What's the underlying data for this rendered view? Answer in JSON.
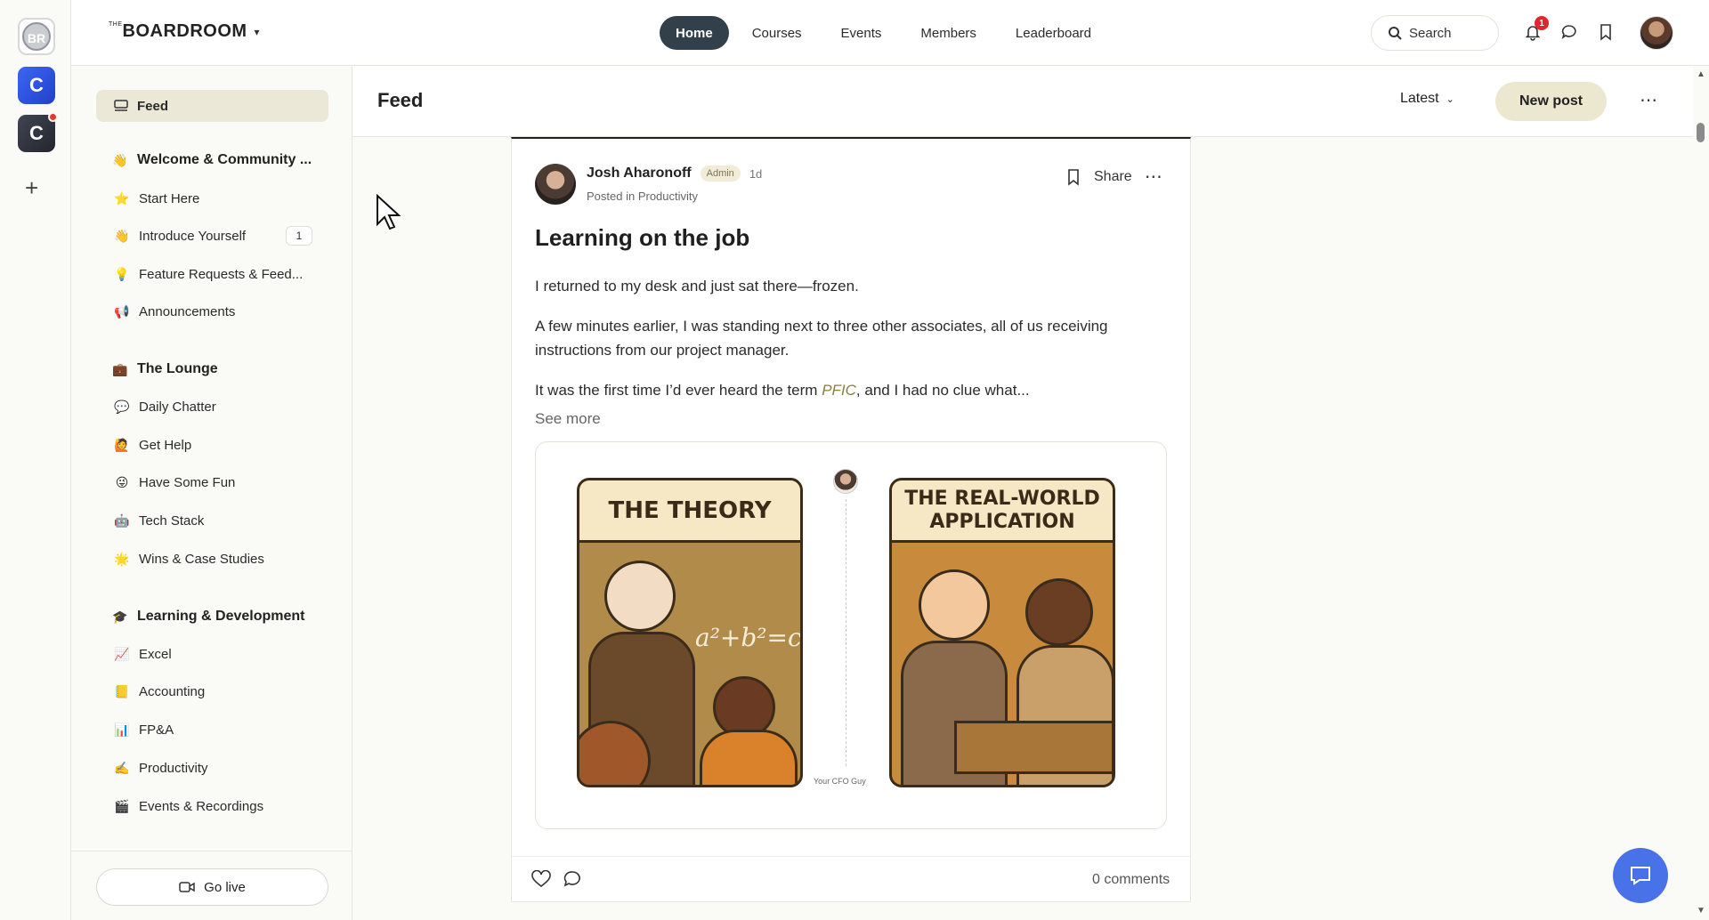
{
  "rail": {
    "apps": [
      {
        "label": "BR"
      },
      {
        "label": "C"
      },
      {
        "label": "C"
      }
    ],
    "add": "+"
  },
  "header": {
    "logo_small": "THE",
    "logo_main": "BOARDROOM",
    "nav": [
      "Home",
      "Courses",
      "Events",
      "Members",
      "Leaderboard"
    ],
    "search_label": "Search",
    "notification_count": "1"
  },
  "sidebar": {
    "feed": "Feed",
    "sections": [
      {
        "title": "Welcome & Community ...",
        "emoji": "👋",
        "items": [
          {
            "label": "Start Here",
            "emoji": "⭐"
          },
          {
            "label": "Introduce Yourself",
            "emoji": "👋",
            "count": "1"
          },
          {
            "label": "Feature Requests & Feed...",
            "emoji": "💡"
          },
          {
            "label": "Announcements",
            "emoji": "📢"
          }
        ]
      },
      {
        "title": "The Lounge",
        "emoji": "💼",
        "items": [
          {
            "label": "Daily Chatter",
            "emoji": "💬"
          },
          {
            "label": "Get Help",
            "emoji": "🙋"
          },
          {
            "label": "Have Some Fun",
            "emoji": "😜"
          },
          {
            "label": "Tech Stack",
            "emoji": "🤖"
          },
          {
            "label": "Wins & Case Studies",
            "emoji": "🌟"
          }
        ]
      },
      {
        "title": "Learning & Development",
        "emoji": "🎓",
        "items": [
          {
            "label": "Excel",
            "emoji": "📈"
          },
          {
            "label": "Accounting",
            "emoji": "📒"
          },
          {
            "label": "FP&A",
            "emoji": "📊"
          },
          {
            "label": "Productivity",
            "emoji": "✍️"
          },
          {
            "label": "Events & Recordings",
            "emoji": "🎬"
          }
        ]
      }
    ],
    "go_live": "Go live"
  },
  "feed": {
    "title": "Feed",
    "sort": "Latest",
    "new_post": "New post",
    "post": {
      "author": "Josh Aharonoff",
      "role": "Admin",
      "time": "1d",
      "posted_in_prefix": "Posted in",
      "posted_in": "Productivity",
      "share": "Share",
      "title": "Learning on the job",
      "p1": "I returned to my desk and just sat there—frozen.",
      "p2": "A few minutes earlier, I was standing next to three other associates, all of us receiving instructions from our project manager.",
      "p3_before": "It was the first time I’d ever heard the term ",
      "p3_term": "PFIC",
      "p3_after": ", and I had no clue what...",
      "see_more": "See more",
      "image": {
        "left_caption": "THE THEORY",
        "left_equation": "a²+b²=c",
        "right_caption": "THE REAL-WORLD APPLICATION",
        "credit": "Your CFO Guy"
      },
      "comments": "0 comments"
    }
  },
  "colors": {
    "accent": "#31404a",
    "new_post_bg": "#ece7cf",
    "active_side": "#ebe8d8",
    "chat_button": "#4a72e8",
    "badge": "#e3262b"
  }
}
